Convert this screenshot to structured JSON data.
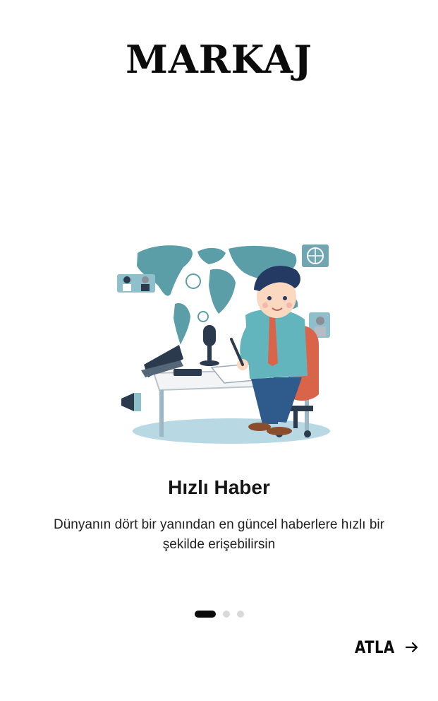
{
  "app": {
    "logo_text": "MARKAJ"
  },
  "onboarding": {
    "illustration_icon": "news-reporter-illustration",
    "title": "Hızlı Haber",
    "description": "Dünyanın dört bir yanından en güncel haberlere hızlı bir şekilde erişebilirsin",
    "pagination": {
      "current_page": 1,
      "total_pages": 3
    },
    "skip_label": "ATLA",
    "skip_icon": "arrow-right-icon"
  },
  "colors": {
    "text_primary": "#161616",
    "dot_active": "#0b0b0b",
    "dot_inactive": "#d9d9d9",
    "map_teal": "#5b9ea8"
  }
}
